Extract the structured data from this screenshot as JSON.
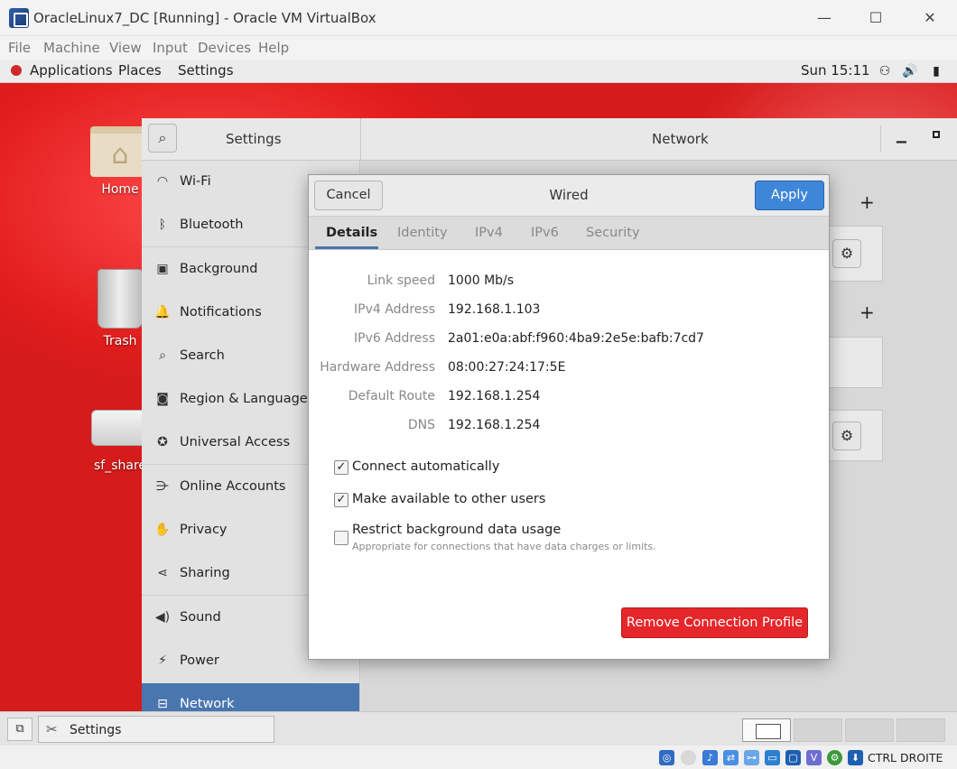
{
  "vbox": {
    "title": "OracleLinux7_DC [Running] - Oracle VM VirtualBox",
    "menu": [
      "File",
      "Machine",
      "View",
      "Input",
      "Devices",
      "Help"
    ],
    "host_key": "CTRL DROITE"
  },
  "guest_topbar": {
    "applications": "Applications",
    "places": "Places",
    "settings": "Settings",
    "clock": "Sun 15:11"
  },
  "desktop_icons": [
    "Home",
    "Trash",
    "sf_share"
  ],
  "settings": {
    "sidebar_title": "Settings",
    "main_title": "Network",
    "items": [
      {
        "label": "Wi-Fi",
        "icon": "wifi-icon"
      },
      {
        "label": "Bluetooth",
        "icon": "bluetooth-icon"
      },
      {
        "label": "Background",
        "icon": "background-icon"
      },
      {
        "label": "Notifications",
        "icon": "bell-icon"
      },
      {
        "label": "Search",
        "icon": "search-icon"
      },
      {
        "label": "Region & Language",
        "icon": "camera-icon"
      },
      {
        "label": "Universal Access",
        "icon": "accessibility-icon"
      },
      {
        "label": "Online Accounts",
        "icon": "online-accounts-icon"
      },
      {
        "label": "Privacy",
        "icon": "hand-icon"
      },
      {
        "label": "Sharing",
        "icon": "share-icon"
      },
      {
        "label": "Sound",
        "icon": "speaker-icon"
      },
      {
        "label": "Power",
        "icon": "power-icon"
      },
      {
        "label": "Network",
        "icon": "network-icon"
      }
    ]
  },
  "dialog": {
    "title": "Wired",
    "cancel": "Cancel",
    "apply": "Apply",
    "tabs": [
      "Details",
      "Identity",
      "IPv4",
      "IPv6",
      "Security"
    ],
    "details": [
      {
        "label": "Link speed",
        "value": "1000 Mb/s"
      },
      {
        "label": "IPv4 Address",
        "value": "192.168.1.103"
      },
      {
        "label": "IPv6 Address",
        "value": "2a01:e0a:abf:f960:4ba9:2e5e:bafb:7cd7"
      },
      {
        "label": "Hardware Address",
        "value": "08:00:27:24:17:5E"
      },
      {
        "label": "Default Route",
        "value": "192.168.1.254"
      },
      {
        "label": "DNS",
        "value": "192.168.1.254"
      }
    ],
    "options": [
      {
        "label": "Connect automatically",
        "checked": true
      },
      {
        "label": "Make available to other users",
        "checked": true
      },
      {
        "label": "Restrict background data usage",
        "checked": false,
        "hint": "Appropriate for connections that have data charges or limits."
      }
    ],
    "remove": "Remove Connection Profile"
  },
  "taskbar": {
    "task_label": "Settings"
  },
  "colors": {
    "accent": "#4a76b0",
    "apply": "#3e86d8",
    "destructive": "#e5262a",
    "desktop": "#d61b1b"
  }
}
